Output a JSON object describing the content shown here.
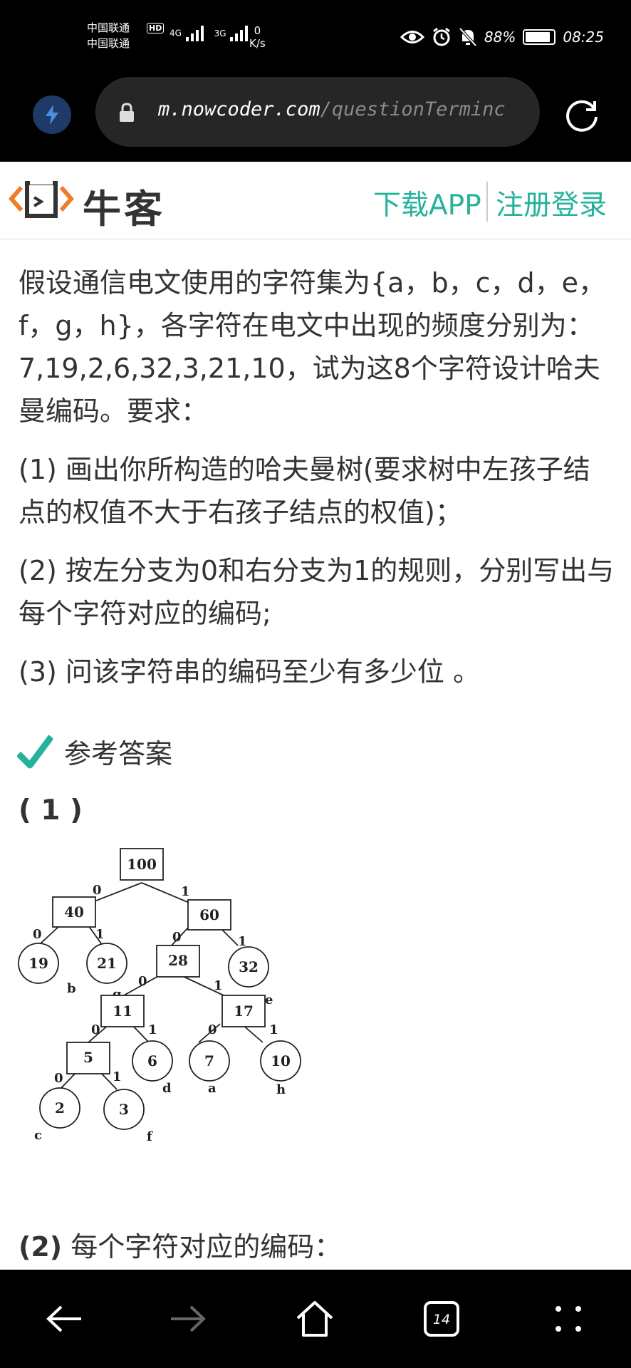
{
  "status_bar": {
    "carrier1": "中国联通",
    "carrier2": "中国联通",
    "hd": "HD",
    "net1": "4G",
    "net2": "3G",
    "speed_value": "0",
    "speed_unit": "K/s",
    "battery": "88%",
    "battery_level": 0.88,
    "time": "08:25"
  },
  "browser": {
    "url_host": "m.nowcoder.com",
    "url_path": "/questionTerminc"
  },
  "site": {
    "brand": "牛客",
    "download": "下载APP",
    "login": "注册登录"
  },
  "question": {
    "intro": "假设通信电文使用的字符集为{a，b，c，d，e，f，g，h}，各字符在电文中出现的频度分别为：7,19,2,6,32,3,21,10，试为这8个字符设计哈夫曼编码。要求：",
    "q1": "(1) 画出你所构造的哈夫曼树(要求树中左孩子结点的权值不大于右孩子结点的权值)；",
    "q2": "(2) 按左分支为0和右分支为1的规则，分别写出与每个字符对应的编码;",
    "q3": "(3) 问该字符串的编码至少有多少位 。"
  },
  "answer": {
    "heading": "参考答案",
    "part1": "( 1 )",
    "part2_num": "(2)",
    "part2_text": " 每个字符对应的编码："
  },
  "tree": {
    "nodes": [
      {
        "label": "100",
        "shape": "box"
      },
      {
        "label": "40",
        "shape": "box"
      },
      {
        "label": "60",
        "shape": "box"
      },
      {
        "label": "19",
        "shape": "circle",
        "leaf": "b"
      },
      {
        "label": "21",
        "shape": "circle",
        "leaf": "g"
      },
      {
        "label": "28",
        "shape": "box"
      },
      {
        "label": "32",
        "shape": "circle",
        "leaf": "e"
      },
      {
        "label": "11",
        "shape": "box"
      },
      {
        "label": "17",
        "shape": "box"
      },
      {
        "label": "5",
        "shape": "box"
      },
      {
        "label": "6",
        "shape": "circle",
        "leaf": "d"
      },
      {
        "label": "7",
        "shape": "circle",
        "leaf": "a"
      },
      {
        "label": "10",
        "shape": "circle",
        "leaf": "h"
      },
      {
        "label": "2",
        "shape": "circle",
        "leaf": "c"
      },
      {
        "label": "3",
        "shape": "circle",
        "leaf": "f"
      }
    ],
    "edge_labels": [
      "0",
      "1"
    ]
  },
  "colors": {
    "accent": "#25b29a",
    "text": "#333333"
  }
}
